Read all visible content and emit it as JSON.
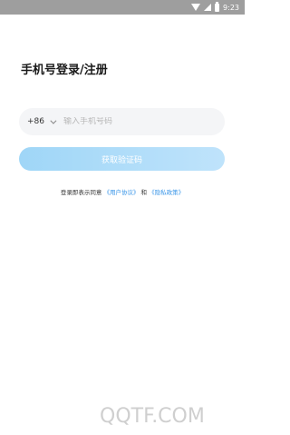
{
  "status_bar": {
    "time": "9:23",
    "icons": [
      "wifi-icon",
      "signal-icon",
      "battery-icon"
    ]
  },
  "login": {
    "title": "手机号登录/注册",
    "country_code": "+86",
    "phone_placeholder": "输入手机号码",
    "get_code_label": "获取验证码",
    "agreement_prefix": "登录即表示同意",
    "user_agreement": "《用户协议》",
    "agreement_and": "和",
    "privacy_policy": "《隐私政策》"
  },
  "watermark": "QQTF.COM",
  "colors": {
    "status_bar": "#9e9e9e",
    "button_start": "#9fd6f7",
    "button_end": "#bfe3fb",
    "link": "#3a96e8",
    "input_bg": "#f4f5f7"
  }
}
